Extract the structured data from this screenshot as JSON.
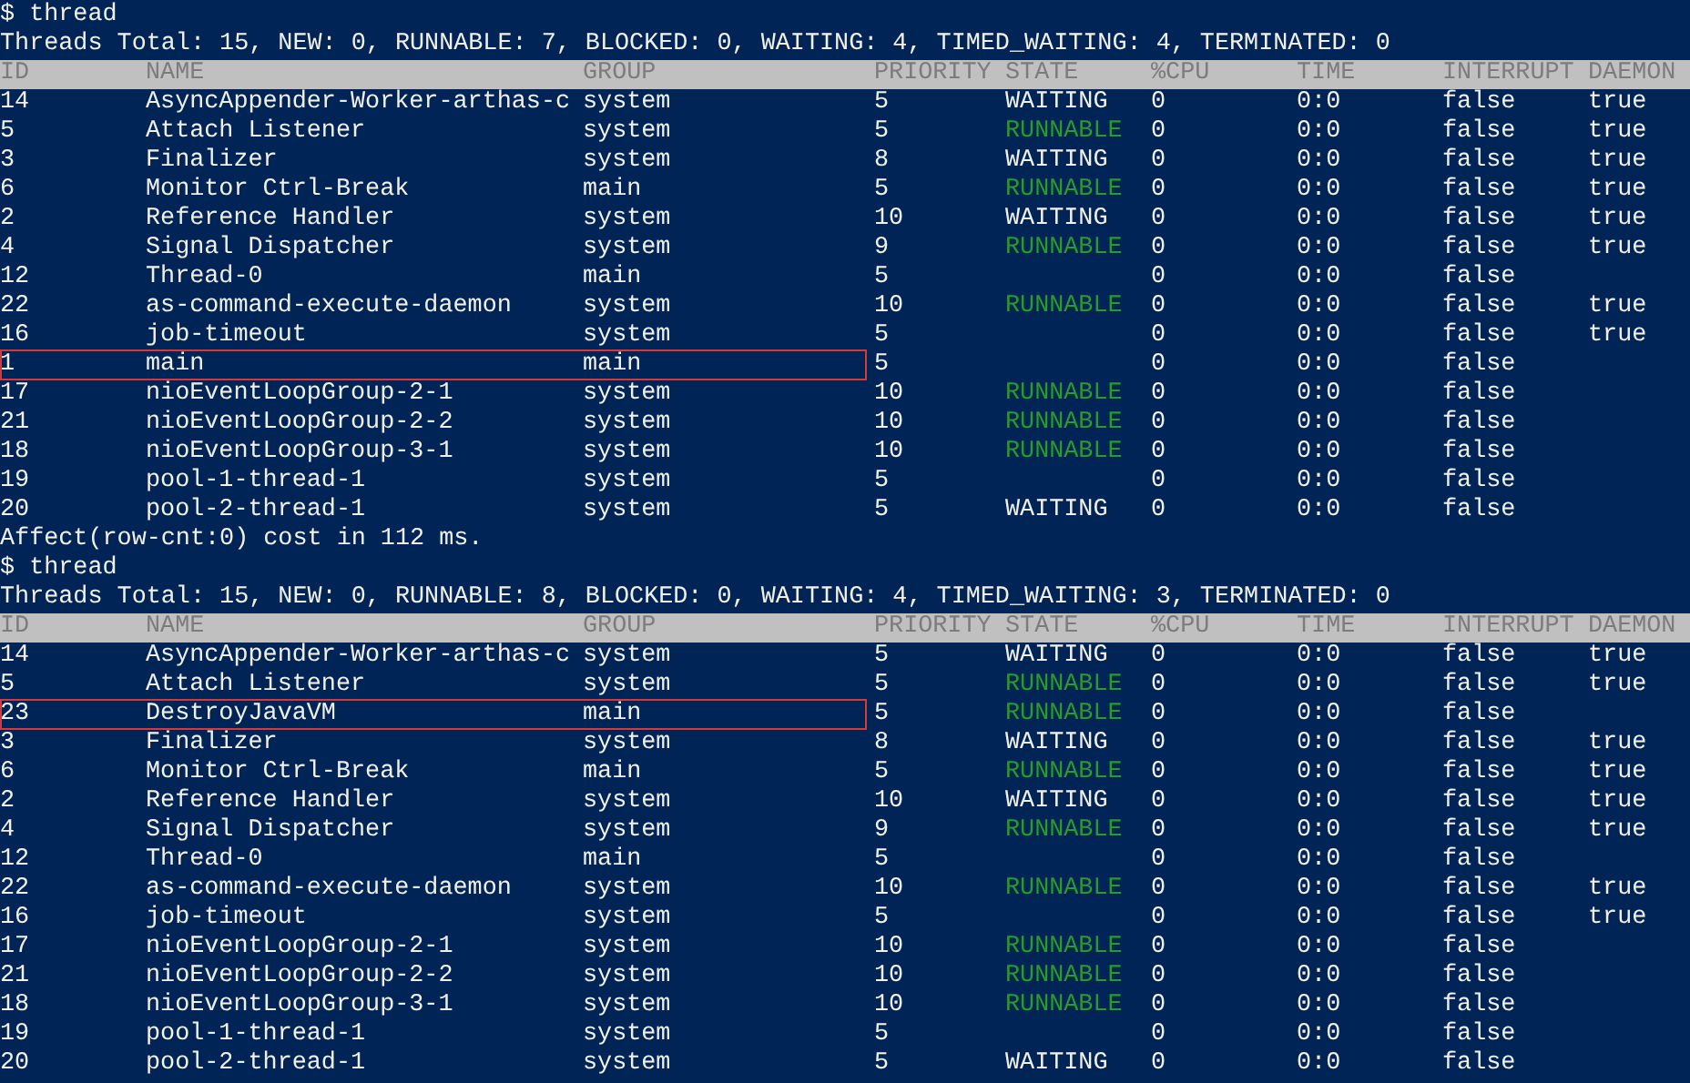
{
  "sessions": [
    {
      "command": "$ thread",
      "summary": "Threads Total: 15, NEW: 0, RUNNABLE: 7, BLOCKED: 0, WAITING: 4, TIMED_WAITING: 4, TERMINATED: 0",
      "columns": [
        "ID",
        "NAME",
        "GROUP",
        "PRIORITY",
        "STATE",
        "%CPU",
        "TIME",
        "INTERRUPT",
        "DAEMON"
      ],
      "rows": [
        {
          "id": "14",
          "name": "AsyncAppender-Worker-arthas-c",
          "group": "system",
          "priority": "5",
          "state": {
            "text": "WAITING",
            "color": "#f0f0e8"
          },
          "cpu": "0",
          "time": "0:0",
          "interrupt": "false",
          "daemon": "true",
          "highlighted": false
        },
        {
          "id": "5",
          "name": "Attach Listener",
          "group": "system",
          "priority": "5",
          "state": {
            "text": "RUNNABLE",
            "color": "#2a9a2a"
          },
          "cpu": "0",
          "time": "0:0",
          "interrupt": "false",
          "daemon": "true",
          "highlighted": false
        },
        {
          "id": "3",
          "name": "Finalizer",
          "group": "system",
          "priority": "8",
          "state": {
            "text": "WAITING",
            "color": "#f0f0e8"
          },
          "cpu": "0",
          "time": "0:0",
          "interrupt": "false",
          "daemon": "true",
          "highlighted": false
        },
        {
          "id": "6",
          "name": "Monitor Ctrl-Break",
          "group": "main",
          "priority": "5",
          "state": {
            "text": "RUNNABLE",
            "color": "#2a9a2a"
          },
          "cpu": "0",
          "time": "0:0",
          "interrupt": "false",
          "daemon": "true",
          "highlighted": false
        },
        {
          "id": "2",
          "name": "Reference Handler",
          "group": "system",
          "priority": "10",
          "state": {
            "text": "WAITING",
            "color": "#f0f0e8"
          },
          "cpu": "0",
          "time": "0:0",
          "interrupt": "false",
          "daemon": "true",
          "highlighted": false
        },
        {
          "id": "4",
          "name": "Signal Dispatcher",
          "group": "system",
          "priority": "9",
          "state": {
            "text": "RUNNABLE",
            "color": "#2a9a2a"
          },
          "cpu": "0",
          "time": "0:0",
          "interrupt": "false",
          "daemon": "true",
          "highlighted": false
        },
        {
          "id": "12",
          "name": "Thread-0",
          "group": "main",
          "priority": "5",
          "cpu": "0",
          "time": "0:0",
          "interrupt": "false",
          "highlighted": false
        },
        {
          "id": "22",
          "name": "as-command-execute-daemon",
          "group": "system",
          "priority": "10",
          "state": {
            "text": "RUNNABLE",
            "color": "#2a9a2a"
          },
          "cpu": "0",
          "time": "0:0",
          "interrupt": "false",
          "daemon": "true",
          "highlighted": false
        },
        {
          "id": "16",
          "name": "job-timeout",
          "group": "system",
          "priority": "5",
          "cpu": "0",
          "time": "0:0",
          "interrupt": "false",
          "daemon": "true",
          "highlighted": false
        },
        {
          "id": "1",
          "name": "main",
          "group": "main",
          "priority": "5",
          "cpu": "0",
          "time": "0:0",
          "interrupt": "false",
          "highlighted": true
        },
        {
          "id": "17",
          "name": "nioEventLoopGroup-2-1",
          "group": "system",
          "priority": "10",
          "state": {
            "text": "RUNNABLE",
            "color": "#2a9a2a"
          },
          "cpu": "0",
          "time": "0:0",
          "interrupt": "false",
          "highlighted": false
        },
        {
          "id": "21",
          "name": "nioEventLoopGroup-2-2",
          "group": "system",
          "priority": "10",
          "state": {
            "text": "RUNNABLE",
            "color": "#2a9a2a"
          },
          "cpu": "0",
          "time": "0:0",
          "interrupt": "false",
          "highlighted": false
        },
        {
          "id": "18",
          "name": "nioEventLoopGroup-3-1",
          "group": "system",
          "priority": "10",
          "state": {
            "text": "RUNNABLE",
            "color": "#2a9a2a"
          },
          "cpu": "0",
          "time": "0:0",
          "interrupt": "false",
          "highlighted": false
        },
        {
          "id": "19",
          "name": "pool-1-thread-1",
          "group": "system",
          "priority": "5",
          "cpu": "0",
          "time": "0:0",
          "interrupt": "false",
          "highlighted": false
        },
        {
          "id": "20",
          "name": "pool-2-thread-1",
          "group": "system",
          "priority": "5",
          "state": {
            "text": "WAITING",
            "color": "#f0f0e8"
          },
          "cpu": "0",
          "time": "0:0",
          "interrupt": "false",
          "highlighted": false
        }
      ],
      "footer": "Affect(row-cnt:0) cost in 112 ms."
    },
    {
      "command": "$ thread",
      "summary": "Threads Total: 15, NEW: 0, RUNNABLE: 8, BLOCKED: 0, WAITING: 4, TIMED_WAITING: 3, TERMINATED: 0",
      "columns": [
        "ID",
        "NAME",
        "GROUP",
        "PRIORITY",
        "STATE",
        "%CPU",
        "TIME",
        "INTERRUPT",
        "DAEMON"
      ],
      "rows": [
        {
          "id": "14",
          "name": "AsyncAppender-Worker-arthas-c",
          "group": "system",
          "priority": "5",
          "state": {
            "text": "WAITING",
            "color": "#f0f0e8"
          },
          "cpu": "0",
          "time": "0:0",
          "interrupt": "false",
          "daemon": "true",
          "highlighted": false
        },
        {
          "id": "5",
          "name": "Attach Listener",
          "group": "system",
          "priority": "5",
          "state": {
            "text": "RUNNABLE",
            "color": "#2a9a2a"
          },
          "cpu": "0",
          "time": "0:0",
          "interrupt": "false",
          "daemon": "true",
          "highlighted": false
        },
        {
          "id": "23",
          "name": "DestroyJavaVM",
          "group": "main",
          "priority": "5",
          "state": {
            "text": "RUNNABLE",
            "color": "#2a9a2a"
          },
          "cpu": "0",
          "time": "0:0",
          "interrupt": "false",
          "highlighted": true
        },
        {
          "id": "3",
          "name": "Finalizer",
          "group": "system",
          "priority": "8",
          "state": {
            "text": "WAITING",
            "color": "#f0f0e8"
          },
          "cpu": "0",
          "time": "0:0",
          "interrupt": "false",
          "daemon": "true",
          "highlighted": false
        },
        {
          "id": "6",
          "name": "Monitor Ctrl-Break",
          "group": "main",
          "priority": "5",
          "state": {
            "text": "RUNNABLE",
            "color": "#2a9a2a"
          },
          "cpu": "0",
          "time": "0:0",
          "interrupt": "false",
          "daemon": "true",
          "highlighted": false
        },
        {
          "id": "2",
          "name": "Reference Handler",
          "group": "system",
          "priority": "10",
          "state": {
            "text": "WAITING",
            "color": "#f0f0e8"
          },
          "cpu": "0",
          "time": "0:0",
          "interrupt": "false",
          "daemon": "true",
          "highlighted": false
        },
        {
          "id": "4",
          "name": "Signal Dispatcher",
          "group": "system",
          "priority": "9",
          "state": {
            "text": "RUNNABLE",
            "color": "#2a9a2a"
          },
          "cpu": "0",
          "time": "0:0",
          "interrupt": "false",
          "daemon": "true",
          "highlighted": false
        },
        {
          "id": "12",
          "name": "Thread-0",
          "group": "main",
          "priority": "5",
          "cpu": "0",
          "time": "0:0",
          "interrupt": "false",
          "highlighted": false
        },
        {
          "id": "22",
          "name": "as-command-execute-daemon",
          "group": "system",
          "priority": "10",
          "state": {
            "text": "RUNNABLE",
            "color": "#2a9a2a"
          },
          "cpu": "0",
          "time": "0:0",
          "interrupt": "false",
          "daemon": "true",
          "highlighted": false
        },
        {
          "id": "16",
          "name": "job-timeout",
          "group": "system",
          "priority": "5",
          "cpu": "0",
          "time": "0:0",
          "interrupt": "false",
          "daemon": "true",
          "highlighted": false
        },
        {
          "id": "17",
          "name": "nioEventLoopGroup-2-1",
          "group": "system",
          "priority": "10",
          "state": {
            "text": "RUNNABLE",
            "color": "#2a9a2a"
          },
          "cpu": "0",
          "time": "0:0",
          "interrupt": "false",
          "highlighted": false
        },
        {
          "id": "21",
          "name": "nioEventLoopGroup-2-2",
          "group": "system",
          "priority": "10",
          "state": {
            "text": "RUNNABLE",
            "color": "#2a9a2a"
          },
          "cpu": "0",
          "time": "0:0",
          "interrupt": "false",
          "highlighted": false
        },
        {
          "id": "18",
          "name": "nioEventLoopGroup-3-1",
          "group": "system",
          "priority": "10",
          "state": {
            "text": "RUNNABLE",
            "color": "#2a9a2a"
          },
          "cpu": "0",
          "time": "0:0",
          "interrupt": "false",
          "highlighted": false
        },
        {
          "id": "19",
          "name": "pool-1-thread-1",
          "group": "system",
          "priority": "5",
          "cpu": "0",
          "time": "0:0",
          "interrupt": "false",
          "highlighted": false
        },
        {
          "id": "20",
          "name": "pool-2-thread-1",
          "group": "system",
          "priority": "5",
          "state": {
            "text": "WAITING",
            "color": "#f0f0e8"
          },
          "cpu": "0",
          "time": "0:0",
          "interrupt": "false",
          "highlighted": false
        }
      ]
    }
  ]
}
